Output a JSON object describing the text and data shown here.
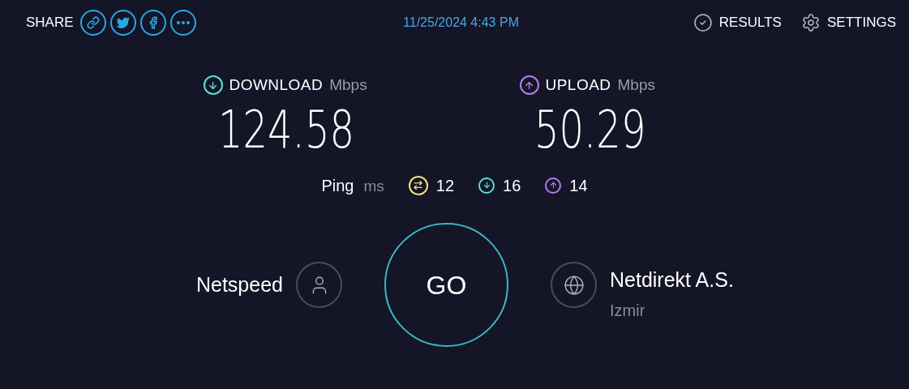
{
  "header": {
    "share_label": "SHARE",
    "share_buttons": [
      {
        "kind": "link"
      },
      {
        "kind": "twitter"
      },
      {
        "kind": "facebook"
      },
      {
        "kind": "more"
      }
    ],
    "timestamp": "11/25/2024 4:43 PM",
    "actions": [
      {
        "kind": "results",
        "label": "RESULTS"
      },
      {
        "kind": "settings",
        "label": "SETTINGS"
      }
    ]
  },
  "metrics": [
    {
      "kind": "download",
      "label": "DOWNLOAD",
      "unit": "Mbps",
      "value": "124.58"
    },
    {
      "kind": "upload",
      "label": "UPLOAD",
      "unit": "Mbps",
      "value": "50.29"
    }
  ],
  "ping": {
    "label": "Ping",
    "unit": "ms",
    "readings": [
      {
        "kind": "idle",
        "value": "12"
      },
      {
        "kind": "download",
        "value": "16"
      },
      {
        "kind": "upload",
        "value": "14"
      }
    ]
  },
  "provider": {
    "name": "Netspeed"
  },
  "go_button": {
    "label": "GO"
  },
  "server": {
    "name": "Netdirekt A.S.",
    "location": "Izmir"
  }
}
